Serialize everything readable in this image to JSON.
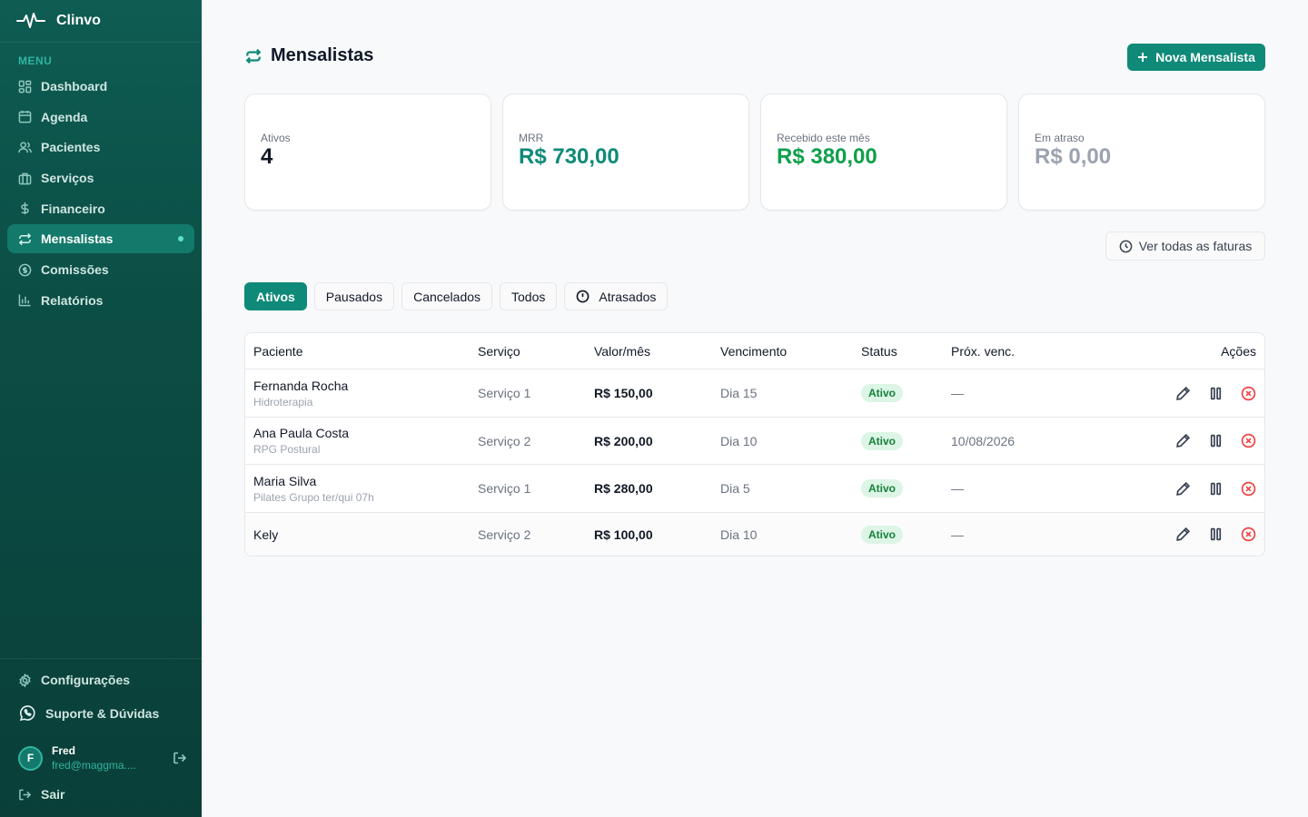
{
  "app": {
    "name": "Clinvo"
  },
  "sidebar": {
    "menu_label": "MENU",
    "items": [
      {
        "label": "Dashboard",
        "icon": "dashboard-icon"
      },
      {
        "label": "Agenda",
        "icon": "calendar-icon"
      },
      {
        "label": "Pacientes",
        "icon": "users-icon"
      },
      {
        "label": "Serviços",
        "icon": "briefcase-icon"
      },
      {
        "label": "Financeiro",
        "icon": "dollar-icon"
      },
      {
        "label": "Mensalistas",
        "icon": "repeat-icon",
        "active": true
      },
      {
        "label": "Comissões",
        "icon": "coin-icon"
      },
      {
        "label": "Relatórios",
        "icon": "bar-chart-icon"
      }
    ],
    "settings_label": "Configurações",
    "support_label": "Suporte & Dúvidas",
    "user": {
      "initial": "F",
      "name": "Fred",
      "email": "fred@maggma...."
    },
    "logout_label": "Sair"
  },
  "page": {
    "title": "Mensalistas",
    "new_button": "Nova Mensalista",
    "invoices_button": "Ver todas as faturas"
  },
  "stats": [
    {
      "label": "Ativos",
      "value": "4"
    },
    {
      "label": "MRR",
      "value": "R$ 730,00"
    },
    {
      "label": "Recebido este mês",
      "value": "R$ 380,00"
    },
    {
      "label": "Em atraso",
      "value": "R$ 0,00"
    }
  ],
  "tabs": [
    "Ativos",
    "Pausados",
    "Cancelados",
    "Todos",
    "Atrasados"
  ],
  "table": {
    "headers": [
      "Paciente",
      "Serviço",
      "Valor/mês",
      "Vencimento",
      "Status",
      "Próx. venc.",
      "Ações"
    ],
    "rows": [
      {
        "name": "Fernanda Rocha",
        "sub": "Hidroterapia",
        "service": "Serviço 1",
        "value": "R$ 150,00",
        "due": "Dia 15",
        "status": "Ativo",
        "next": "—"
      },
      {
        "name": "Ana Paula Costa",
        "sub": "RPG Postural",
        "service": "Serviço 2",
        "value": "R$ 200,00",
        "due": "Dia 10",
        "status": "Ativo",
        "next": "10/08/2026"
      },
      {
        "name": "Maria Silva",
        "sub": "Pilates Grupo ter/qui 07h",
        "service": "Serviço 1",
        "value": "R$ 280,00",
        "due": "Dia 5",
        "status": "Ativo",
        "next": "—"
      },
      {
        "name": "Kely",
        "sub": "",
        "service": "Serviço 2",
        "value": "R$ 100,00",
        "due": "Dia 10",
        "status": "Ativo",
        "next": "—"
      }
    ]
  },
  "colors": {
    "accent": "#0f8a78",
    "sidebar": "#0b4d45",
    "received": "#10a04c",
    "danger": "#ef4444"
  }
}
